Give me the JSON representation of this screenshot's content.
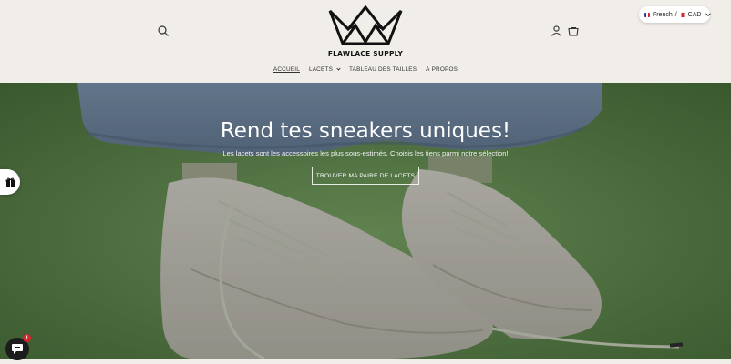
{
  "brand": {
    "name": "FLAWLACE SUPPLY"
  },
  "locale": {
    "language": "French",
    "separator": "/",
    "currency": "CAD"
  },
  "nav": {
    "items": [
      {
        "label": "ACCUEIL",
        "active": true
      },
      {
        "label": "LACETS",
        "has_dropdown": true
      },
      {
        "label": "TABLEAU DES TAILLES"
      },
      {
        "label": "À PROPOS"
      }
    ]
  },
  "hero": {
    "title": "Rend tes sneakers uniques!",
    "subtitle": "Les lacets sont les accessoires les plus sous-estimés. Choisis les tiens parmi notre sélection!",
    "cta_label": "TROUVER MA PAIRE DE LACETS"
  },
  "chat": {
    "badge_count": "1"
  },
  "icons": [
    "search-icon",
    "account-icon",
    "cart-icon",
    "crown-logo-icon",
    "gift-icon",
    "chat-icon",
    "chevron-down-icon"
  ],
  "colors": {
    "background": "#f1ede8",
    "hero_green": "#6e9c5b",
    "badge_red": "#d8232a"
  }
}
